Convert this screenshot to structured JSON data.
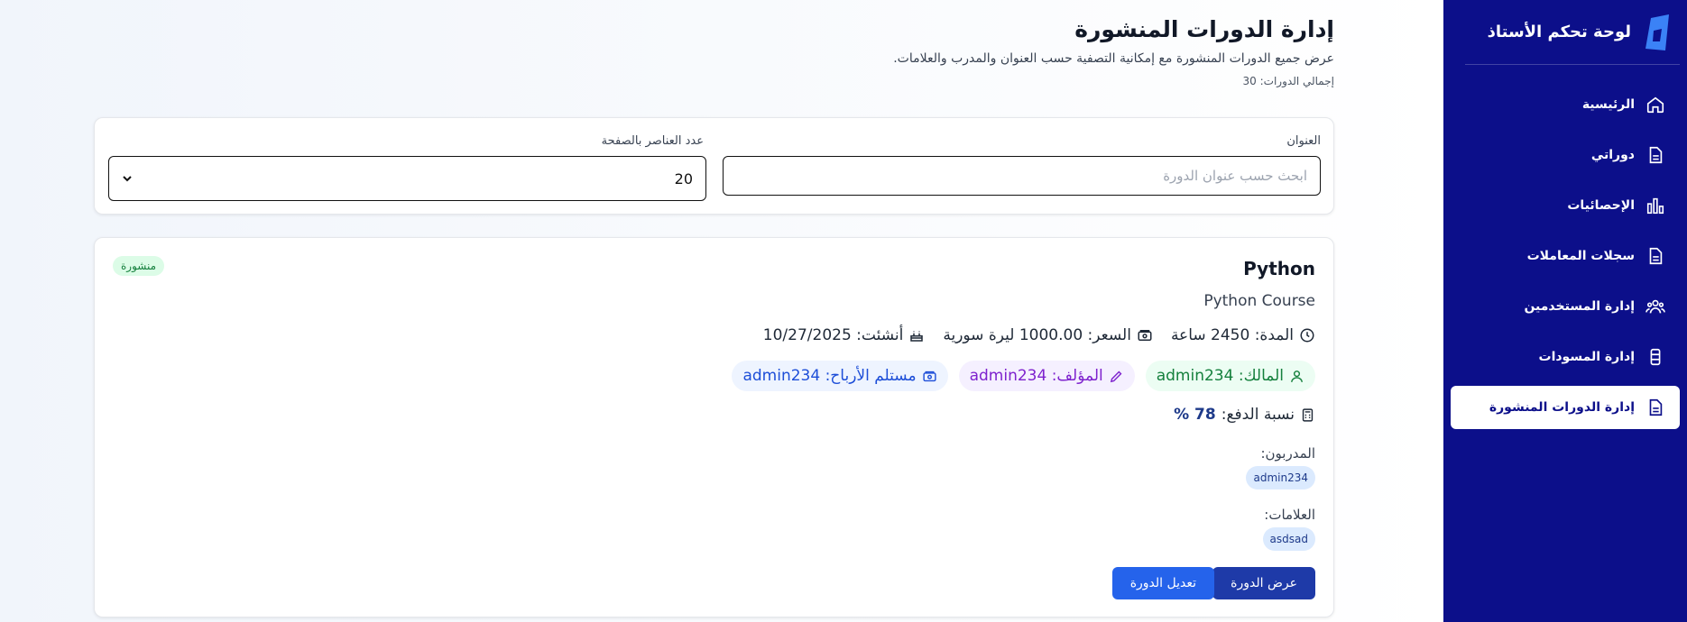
{
  "sidebar": {
    "brand_title": "لوحة تحكم الأستاذ",
    "items": [
      {
        "label": "الرئيسية",
        "icon": "home-icon",
        "active": false
      },
      {
        "label": "دوراتي",
        "icon": "document-icon",
        "active": false
      },
      {
        "label": "الإحصائيات",
        "icon": "chart-icon",
        "active": false
      },
      {
        "label": "سجلات المعاملات",
        "icon": "document-icon",
        "active": false
      },
      {
        "label": "إدارة المستخدمين",
        "icon": "users-icon",
        "active": false
      },
      {
        "label": "إدارة المسودات",
        "icon": "drafts-icon",
        "active": false
      },
      {
        "label": "إدارة الدورات المنشورة",
        "icon": "document-icon",
        "active": true
      }
    ]
  },
  "header": {
    "title": "إدارة الدورات المنشورة",
    "subtitle": "عرض جميع الدورات المنشورة مع إمكانية التصفية حسب العنوان والمدرب والعلامات.",
    "total": "إجمالي الدورات: 30"
  },
  "filters": {
    "title_label": "العنوان",
    "title_placeholder": "ابحث حسب عنوان الدورة",
    "title_value": "",
    "page_size_label": "عدد العناصر بالصفحة",
    "page_size_value": "20"
  },
  "course": {
    "title": "Python",
    "subtitle": "Python Course",
    "status": "منشورة",
    "duration": "المدة: 2450 ساعة",
    "price": "السعر: 1000.00 ليرة سورية",
    "created": "أنشئت: 10/27/2025",
    "owner": "المالك: admin234",
    "author": "المؤلف: admin234",
    "receiver": "مستلم الأرباح: admin234",
    "pay_label": "نسبة الدفع:",
    "pay_value": "78 %",
    "trainers_label": "المدربون:",
    "trainers": [
      "admin234"
    ],
    "tags_label": "العلامات:",
    "tags": [
      "asdsad"
    ],
    "view_button": "عرض الدورة",
    "edit_button": "تعديل الدورة"
  },
  "colors": {
    "sidebar_bg": "#0c0f8a",
    "primary_button": "#1e3aa8",
    "secondary_button": "#2563eb",
    "status_green": "#15803d"
  }
}
